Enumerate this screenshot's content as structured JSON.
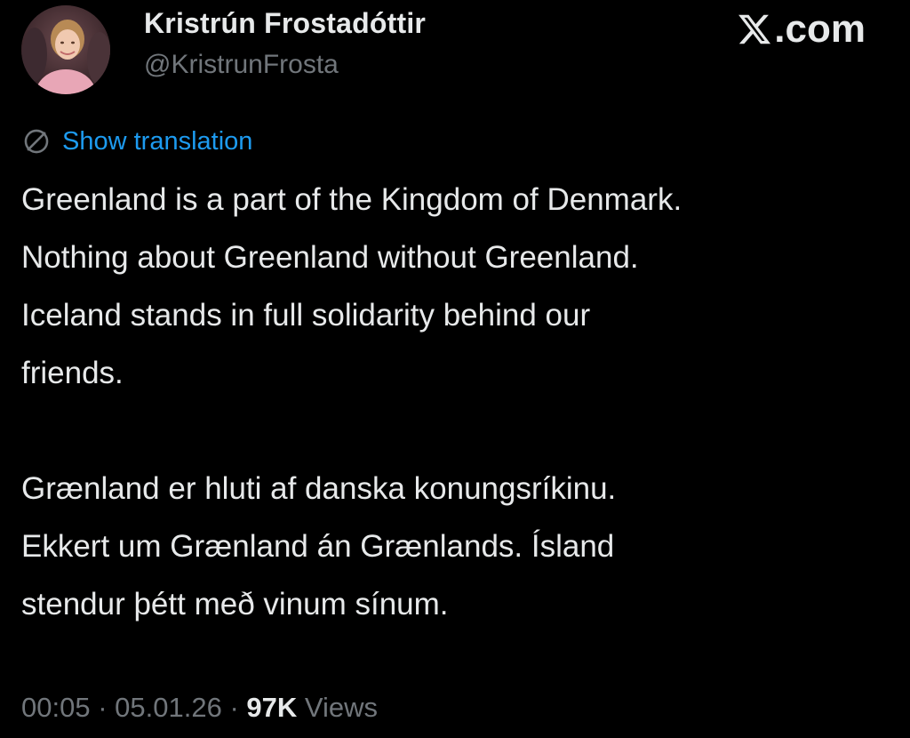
{
  "author": {
    "display_name": "Kristrún Frostadóttir",
    "handle": "@KristrunFrosta",
    "avatar_icon": "profile-photo"
  },
  "watermark": {
    "suffix": ".com",
    "logo_icon": "x-logo-icon"
  },
  "translation": {
    "label": "Show translation",
    "icon": "globe-icon",
    "link_color": "#1d9bf0"
  },
  "post": {
    "paragraph_1": [
      "Greenland is a part of the Kingdom of Denmark.",
      "Nothing about Greenland without Greenland.",
      "Iceland stands in full solidarity behind our",
      "friends."
    ],
    "paragraph_2": [
      "Grænland er hluti af danska konungsríkinu.",
      "Ekkert um Grænland án Grænlands. Ísland",
      "stendur þétt með vinum sínum."
    ]
  },
  "meta": {
    "time": "00:05",
    "separator": "·",
    "date": "05.01.26",
    "views_count": "97K",
    "views_label": "Views"
  },
  "colors": {
    "background": "#000000",
    "text_primary": "#e7e9ea",
    "text_secondary": "#71767b"
  }
}
